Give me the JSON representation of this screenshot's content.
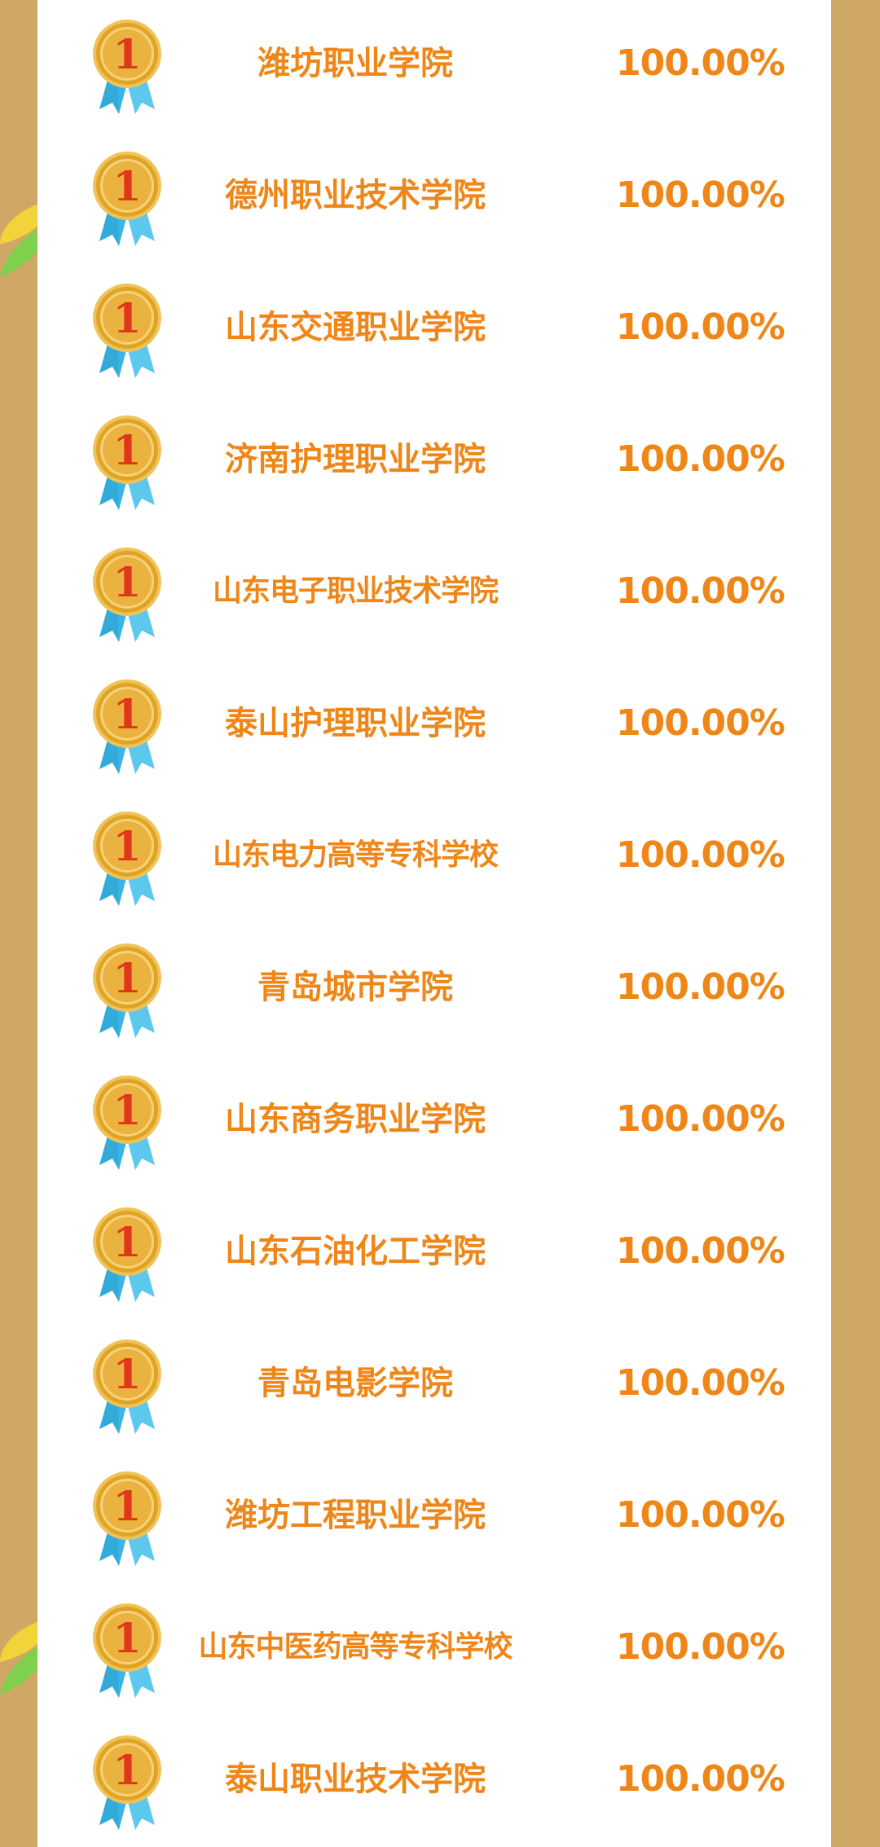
{
  "colors": {
    "background": "#cfa866",
    "panel": "#ffffff",
    "text_accent": "#ef8618",
    "medal_gold": "#e0a425",
    "medal_number": "#e0361c",
    "ribbon": "#3bb6e4"
  },
  "medal_icon": "gold-medal-rank-1",
  "rankings": [
    {
      "rank": "1",
      "school": "潍坊职业学院",
      "rate": "100.00%"
    },
    {
      "rank": "1",
      "school": "德州职业技术学院",
      "rate": "100.00%"
    },
    {
      "rank": "1",
      "school": "山东交通职业学院",
      "rate": "100.00%"
    },
    {
      "rank": "1",
      "school": "济南护理职业学院",
      "rate": "100.00%"
    },
    {
      "rank": "1",
      "school": "山东电子职业技术学院",
      "rate": "100.00%"
    },
    {
      "rank": "1",
      "school": "泰山护理职业学院",
      "rate": "100.00%"
    },
    {
      "rank": "1",
      "school": "山东电力高等专科学校",
      "rate": "100.00%"
    },
    {
      "rank": "1",
      "school": "青岛城市学院",
      "rate": "100.00%"
    },
    {
      "rank": "1",
      "school": "山东商务职业学院",
      "rate": "100.00%"
    },
    {
      "rank": "1",
      "school": "山东石油化工学院",
      "rate": "100.00%"
    },
    {
      "rank": "1",
      "school": "青岛电影学院",
      "rate": "100.00%"
    },
    {
      "rank": "1",
      "school": "潍坊工程职业学院",
      "rate": "100.00%"
    },
    {
      "rank": "1",
      "school": "山东中医药高等专科学校",
      "rate": "100.00%"
    },
    {
      "rank": "1",
      "school": "泰山职业技术学院",
      "rate": "100.00%"
    }
  ]
}
